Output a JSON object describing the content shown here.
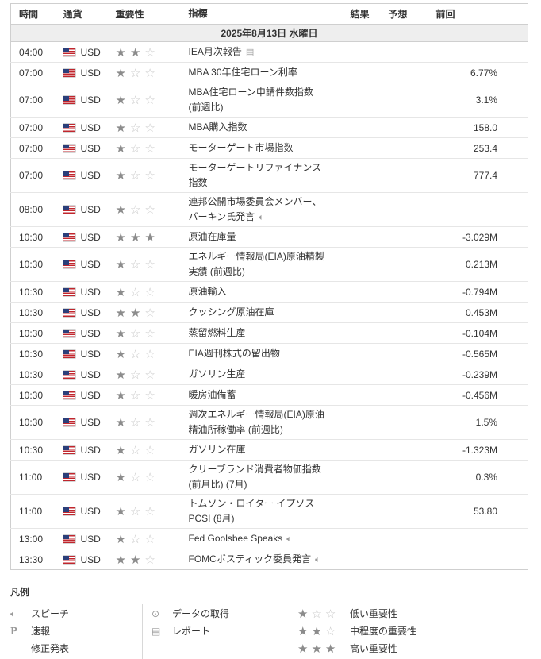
{
  "headers": {
    "time": "時間",
    "currency": "通貨",
    "importance": "重要性",
    "event": "指標",
    "actual": "結果",
    "forecast": "予想",
    "previous": "前回"
  },
  "date_label": "2025年8月13日 水曜日",
  "events": [
    {
      "time": "04:00",
      "currency": "USD",
      "importance": 2,
      "name": [
        "IEA月次報告"
      ],
      "icon": "report-icon",
      "previous": ""
    },
    {
      "time": "07:00",
      "currency": "USD",
      "importance": 1,
      "name": [
        "MBA 30年住宅ローン利率"
      ],
      "icon": "",
      "previous": "6.77%"
    },
    {
      "time": "07:00",
      "currency": "USD",
      "importance": 1,
      "name": [
        "MBA住宅ローン申請件数指数",
        "(前週比)"
      ],
      "icon": "",
      "previous": "3.1%"
    },
    {
      "time": "07:00",
      "currency": "USD",
      "importance": 1,
      "name": [
        "MBA購入指数"
      ],
      "icon": "",
      "previous": "158.0"
    },
    {
      "time": "07:00",
      "currency": "USD",
      "importance": 1,
      "name": [
        "モーターゲート市場指数"
      ],
      "icon": "",
      "previous": "253.4"
    },
    {
      "time": "07:00",
      "currency": "USD",
      "importance": 1,
      "name": [
        "モーターゲートリファイナンス",
        "指数"
      ],
      "icon": "",
      "previous": "777.4"
    },
    {
      "time": "08:00",
      "currency": "USD",
      "importance": 1,
      "name": [
        "連邦公開市場委員会メンバー、",
        "バーキン氏発言"
      ],
      "icon": "speech-icon",
      "previous": ""
    },
    {
      "time": "10:30",
      "currency": "USD",
      "importance": 3,
      "name": [
        "原油在庫量"
      ],
      "icon": "",
      "previous": "-3.029M"
    },
    {
      "time": "10:30",
      "currency": "USD",
      "importance": 1,
      "name": [
        "エネルギー情報局(EIA)原油精製",
        "実績 (前週比)"
      ],
      "icon": "",
      "previous": "0.213M"
    },
    {
      "time": "10:30",
      "currency": "USD",
      "importance": 1,
      "name": [
        "原油輸入"
      ],
      "icon": "",
      "previous": "-0.794M"
    },
    {
      "time": "10:30",
      "currency": "USD",
      "importance": 2,
      "name": [
        "クッシング原油在庫"
      ],
      "icon": "",
      "previous": "0.453M"
    },
    {
      "time": "10:30",
      "currency": "USD",
      "importance": 1,
      "name": [
        "蒸留燃料生産"
      ],
      "icon": "",
      "previous": "-0.104M"
    },
    {
      "time": "10:30",
      "currency": "USD",
      "importance": 1,
      "name": [
        "EIA週刊株式の留出物"
      ],
      "icon": "",
      "previous": "-0.565M"
    },
    {
      "time": "10:30",
      "currency": "USD",
      "importance": 1,
      "name": [
        "ガソリン生産"
      ],
      "icon": "",
      "previous": "-0.239M"
    },
    {
      "time": "10:30",
      "currency": "USD",
      "importance": 1,
      "name": [
        "暖房油備蓄"
      ],
      "icon": "",
      "previous": "-0.456M"
    },
    {
      "time": "10:30",
      "currency": "USD",
      "importance": 1,
      "name": [
        "週次エネルギー情報局(EIA)原油",
        "精油所稼働率 (前週比)"
      ],
      "icon": "",
      "previous": "1.5%"
    },
    {
      "time": "10:30",
      "currency": "USD",
      "importance": 1,
      "name": [
        "ガソリン在庫"
      ],
      "icon": "",
      "previous": "-1.323M"
    },
    {
      "time": "11:00",
      "currency": "USD",
      "importance": 1,
      "name": [
        "クリーブランド消費者物価指数",
        "(前月比) (7月)"
      ],
      "icon": "",
      "previous": "0.3%"
    },
    {
      "time": "11:00",
      "currency": "USD",
      "importance": 1,
      "name": [
        "トムソン・ロイター イプソス",
        "PCSI (8月)"
      ],
      "icon": "",
      "previous": "53.80"
    },
    {
      "time": "13:00",
      "currency": "USD",
      "importance": 1,
      "name": [
        "Fed Goolsbee Speaks"
      ],
      "icon": "speech-icon",
      "previous": ""
    },
    {
      "time": "13:30",
      "currency": "USD",
      "importance": 2,
      "name": [
        "FOMCボスティック委員発言"
      ],
      "icon": "speech-icon",
      "previous": ""
    }
  ],
  "legend": {
    "title": "凡例",
    "col1": [
      {
        "icon": "speech-icon",
        "label": "スピーチ"
      },
      {
        "icon": "preliminary-icon",
        "label": "速報"
      },
      {
        "icon": "",
        "label": "修正発表"
      }
    ],
    "col2": [
      {
        "icon": "data-retrieval-icon",
        "label": "データの取得"
      },
      {
        "icon": "report-icon",
        "label": "レポート"
      }
    ],
    "col3": [
      {
        "stars": 1,
        "label": "低い重要性"
      },
      {
        "stars": 2,
        "label": "中程度の重要性"
      },
      {
        "stars": 3,
        "label": "高い重要性"
      }
    ]
  }
}
